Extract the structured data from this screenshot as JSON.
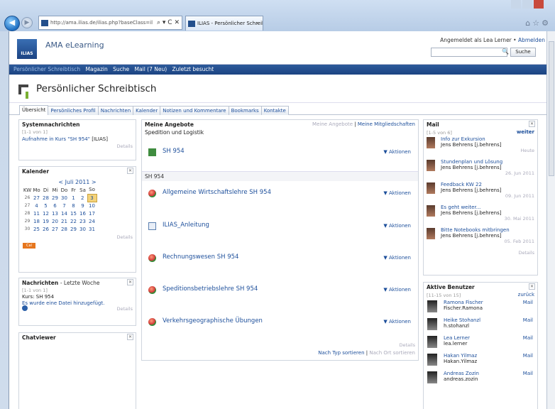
{
  "browser": {
    "address": "http://ama.ilias.de/ilias.php?baseClass=il",
    "address_ctl": "⌕ ▾ C ✕",
    "tab_title": "ILIAS - Persönlicher Schreib...",
    "tab_close": "×"
  },
  "header": {
    "brand": "AMA eLearning",
    "logo": "ILIAS",
    "login_text": "Angemeldet als Lea Lerner •",
    "logout": "Abmelden",
    "search_button": "Suche"
  },
  "nav": [
    "Persönlicher Schreibtisch",
    "Magazin",
    "Suche",
    "Mail (7 Neu)",
    "Zuletzt besucht"
  ],
  "page_title": "Persönlicher Schreibtisch",
  "tabs": [
    "Übersicht",
    "Persönliches Profil",
    "Nachrichten",
    "Kalender",
    "Notizen und Kommentare",
    "Bookmarks",
    "Kontakte"
  ],
  "system": {
    "title": "Systemnachrichten",
    "count": "[1-1 von 1]",
    "link": "Aufnahme in Kurs \"SH 954\"",
    "tag": "[ILIAS]",
    "details": "Details"
  },
  "calendar": {
    "title": "Kalender",
    "month": "< Juli 2011 >",
    "head": [
      "KW",
      "Mo",
      "Di",
      "Mi",
      "Do",
      "Fr",
      "Sa",
      "So"
    ],
    "rows": [
      [
        "26",
        "27",
        "28",
        "29",
        "30",
        "1",
        "2",
        "3"
      ],
      [
        "27",
        "4",
        "5",
        "6",
        "7",
        "8",
        "9",
        "10"
      ],
      [
        "28",
        "11",
        "12",
        "13",
        "14",
        "15",
        "16",
        "17"
      ],
      [
        "29",
        "18",
        "19",
        "20",
        "21",
        "22",
        "23",
        "24"
      ],
      [
        "30",
        "25",
        "26",
        "27",
        "28",
        "29",
        "30",
        "31"
      ]
    ],
    "details": "Details",
    "cal_button": "Cal"
  },
  "news": {
    "title": "Nachrichten",
    "subtitle": "- Letzte Woche",
    "count": "[1-1 von 1]",
    "course": "Kurs: SH 954",
    "text": "Es wurde eine Datei hinzugefügt.",
    "details": "Details"
  },
  "chat": {
    "title": "Chatviewer"
  },
  "offers": {
    "title": "Meine Angebote",
    "view1": "Meine Angebote",
    "sep": "|",
    "view2": "Meine Mitgliedschaften",
    "section1": "Spedition und Logistik",
    "section2": "SH 954",
    "items": [
      {
        "name": "SH 954",
        "action": "Aktionen"
      },
      {
        "name": "Allgemeine Wirtschaftslehre SH 954",
        "action": "Aktionen"
      },
      {
        "name": "ILIAS_Anleitung",
        "action": "Aktionen"
      },
      {
        "name": "Rechnungswesen SH 954",
        "action": "Aktionen"
      },
      {
        "name": "Speditionsbetriebslehre SH 954",
        "action": "Aktionen"
      },
      {
        "name": "Verkehrsgeographische Übungen",
        "action": "Aktionen"
      }
    ],
    "details": "Details",
    "sort1": "Nach Typ sortieren",
    "sort2": "Nach Ort sortieren"
  },
  "mail": {
    "title": "Mail",
    "count": "[1-5 von 6]",
    "more": "weiter",
    "items": [
      {
        "subject": "Info zur Exkursion",
        "from": "Jens Behrens [j.behrens]",
        "date": "Heute"
      },
      {
        "subject": "Stundenplan und Lösung",
        "from": "Jens Behrens [j.behrens]",
        "date": "26. Jun 2011"
      },
      {
        "subject": "Feedback KW 22",
        "from": "Jens Behrens [j.behrens]",
        "date": "09. Jun 2011"
      },
      {
        "subject": "Es geht weiter...",
        "from": "Jens Behrens [j.behrens]",
        "date": "30. Mai 2011"
      },
      {
        "subject": "Bitte Notebooks mitbringen",
        "from": "Jens Behrens [j.behrens]",
        "date": "05. Feb 2011"
      }
    ],
    "details": "Details"
  },
  "users": {
    "title": "Aktive Benutzer",
    "count": "[11-15 von 15]",
    "back": "zurück",
    "items": [
      {
        "name": "Ramona Fischer",
        "login": "Fischer.Ramona",
        "mail": "Mail"
      },
      {
        "name": "Heike Stohanzl",
        "login": "h.stohanzl",
        "mail": "Mail"
      },
      {
        "name": "Lea Lerner",
        "login": "lea.lerner",
        "mail": "Mail"
      },
      {
        "name": "Hakan Yilmaz",
        "login": "Hakan.Yilmaz",
        "mail": "Mail"
      },
      {
        "name": "Andreas Zozin",
        "login": "andreas.zozin",
        "mail": "Mail"
      }
    ]
  }
}
